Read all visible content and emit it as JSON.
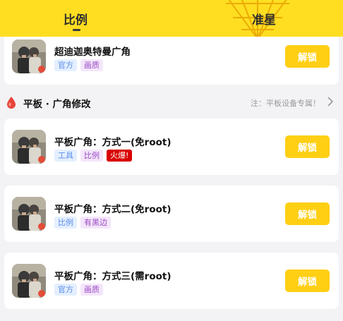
{
  "tabs": [
    {
      "label": "比例",
      "active": true
    },
    {
      "label": "准星",
      "active": false
    }
  ],
  "section": {
    "title": "平板 · 广角修改",
    "note": "注：平板设备专属！"
  },
  "items": [
    {
      "name": "超迪迦奥特曼广角",
      "tags": [
        {
          "text": "官方",
          "color": "blue"
        },
        {
          "text": "画质",
          "color": "purple"
        }
      ],
      "button": "解锁"
    },
    {
      "name": "平板广角：方式一(免root)",
      "tags": [
        {
          "text": "工具",
          "color": "blue"
        },
        {
          "text": "比例",
          "color": "purple"
        },
        {
          "text": "火爆!",
          "color": "red"
        }
      ],
      "button": "解锁"
    },
    {
      "name": "平板广角：方式二(免root)",
      "tags": [
        {
          "text": "比例",
          "color": "blue"
        },
        {
          "text": "有黑边",
          "color": "purple"
        }
      ],
      "button": "解锁"
    },
    {
      "name": "平板广角：方式三(需root)",
      "tags": [
        {
          "text": "官方",
          "color": "blue"
        },
        {
          "text": "画质",
          "color": "purple"
        }
      ],
      "button": "解锁"
    }
  ],
  "colors": {
    "header": "#ffde21",
    "unlock_button": "#ffcf14",
    "hot_tag": "#d90000"
  },
  "icons": [
    "game-thumbnail-icon",
    "flame-drop-icon",
    "chevron-right-icon"
  ]
}
